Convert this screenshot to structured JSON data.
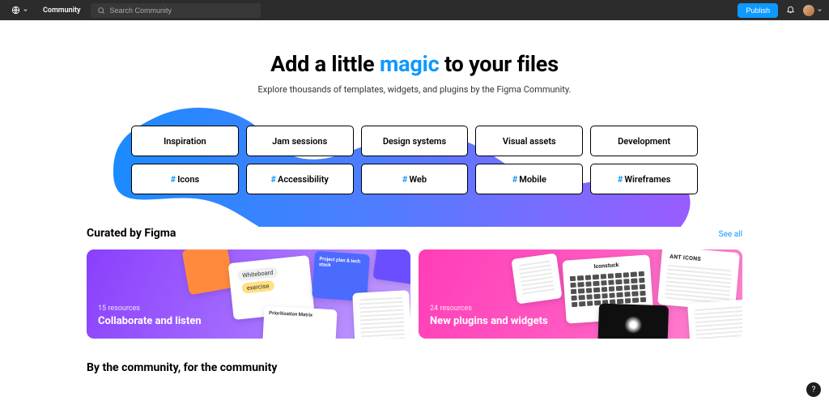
{
  "nav": {
    "community_label": "Community",
    "search_placeholder": "Search Community",
    "publish_label": "Publish"
  },
  "hero": {
    "title_pre": "Add a little ",
    "title_magic": "magic",
    "title_post": " to your files",
    "subtitle": "Explore thousands of templates, widgets, and plugins by the Figma Community."
  },
  "categories_row1": [
    "Inspiration",
    "Jam sessions",
    "Design systems",
    "Visual assets",
    "Development"
  ],
  "categories_row2": [
    "Icons",
    "Accessibility",
    "Web",
    "Mobile",
    "Wireframes"
  ],
  "curated": {
    "heading": "Curated by Figma",
    "see_all": "See all",
    "cards": [
      {
        "count": "15 resources",
        "title": "Collaborate and listen"
      },
      {
        "count": "24 resources",
        "title": "New plugins and widgets"
      }
    ]
  },
  "deco": {
    "whiteboard": "Whiteboard",
    "exercise": "exercise",
    "project_plan": "Project plan & tech stack",
    "prioritization": "Prioritization Matrix",
    "iconstuck": "Iconstuck",
    "ant_icons": "ANT ICONS"
  },
  "section2": {
    "heading": "By the community, for the community"
  },
  "help": "?"
}
